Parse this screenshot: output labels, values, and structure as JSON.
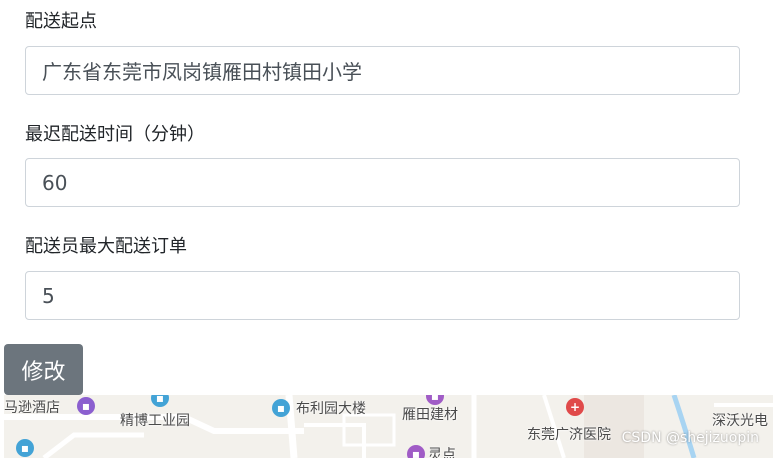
{
  "form": {
    "start_label": "配送起点",
    "start_value": "广东省东莞市凤岗镇雁田村镇田小学",
    "latest_label": "最迟配送时间（分钟）",
    "latest_value": "60",
    "max_orders_label": "配送员最大配送订单",
    "max_orders_value": "5",
    "submit_label": "修改"
  },
  "map": {
    "pois": [
      "马逊酒店",
      "精博工业园",
      "布利园大楼",
      "雁田建材",
      "东莞广济医院",
      "深沃光电",
      "灵点"
    ],
    "colors": {
      "hotel": "#8b5fcf",
      "building": "#43a3d6",
      "hospital": "#e04a4a",
      "shop": "#a05cc6"
    }
  },
  "watermark": "CSDN @shejizuopin"
}
